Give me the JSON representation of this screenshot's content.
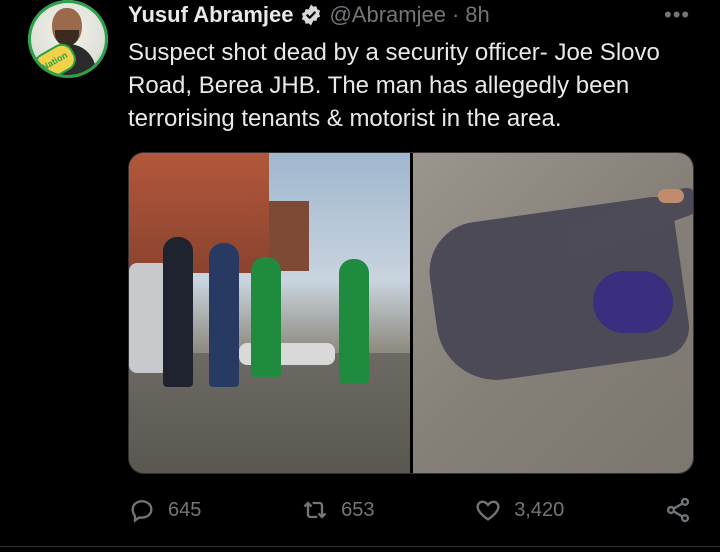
{
  "tweet": {
    "author_name": "Yusuf Abramjee",
    "handle": "@Abramjee",
    "separator": "·",
    "time": "8h",
    "text": "Suspect shot dead by a security officer- Joe Slovo Road, Berea JHB. The man has allegedly been terrorising tenants & motorist in the area.",
    "avatar_badge_text": "Nation",
    "more_label": "•••"
  },
  "actions": {
    "reply_count": "645",
    "retweet_count": "653",
    "like_count": "3,420"
  },
  "colors": {
    "background": "#000000",
    "text": "#e7e9ea",
    "muted": "#71767b",
    "verified": "#d9d9d9"
  }
}
